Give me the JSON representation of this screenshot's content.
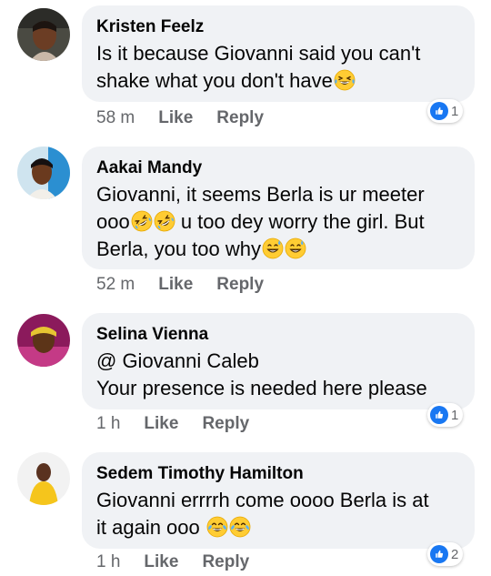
{
  "colors": {
    "bubble_bg": "#f0f2f5",
    "meta_text": "#65676b",
    "like_blue": "#1877f2"
  },
  "comments": [
    {
      "author": "Kristen Feelz",
      "lines": [
        "Is it because Giovanni said you can't",
        "shake what you don't have"
      ],
      "emoji": [
        "crying-laughing"
      ],
      "time": "58 m",
      "like_label": "Like",
      "reply_label": "Reply",
      "reactions": "1"
    },
    {
      "author": "Aakai Mandy",
      "lines": [
        "Giovanni, it seems Berla is ur meeter",
        "ooo",
        " u too dey worry the girl. But",
        "Berla, you too why"
      ],
      "emoji": [
        "rofl",
        "rofl",
        "grin-sweat",
        "grin-sweat"
      ],
      "time": "52 m",
      "like_label": "Like",
      "reply_label": "Reply"
    },
    {
      "author": "Selina Vienna",
      "lines": [
        "@ Giovanni Caleb",
        "Your presence is needed here please"
      ],
      "time": "1 h",
      "like_label": "Like",
      "reply_label": "Reply",
      "reactions": "1"
    },
    {
      "author": "Sedem Timothy Hamilton",
      "lines": [
        "Giovanni errrrh come oooo Berla is at",
        "it again ooo"
      ],
      "emoji": [
        "tears-of-joy",
        "tears-of-joy"
      ],
      "time": "1 h",
      "like_label": "Like",
      "reply_label": "Reply",
      "reactions": "2"
    }
  ]
}
